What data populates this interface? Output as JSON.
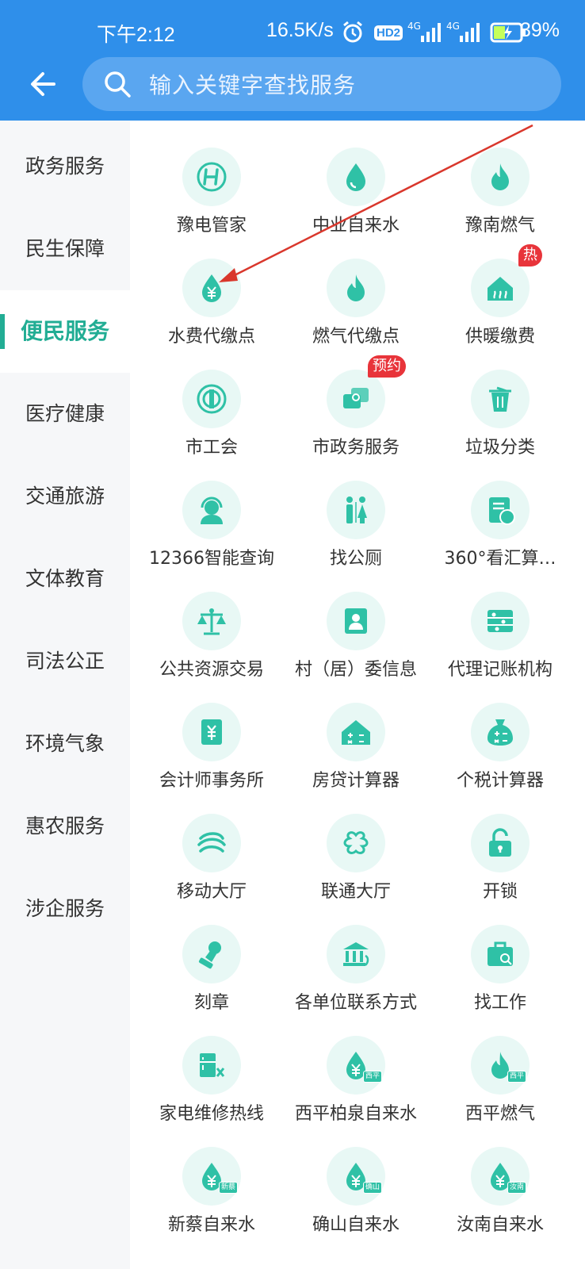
{
  "status_bar": {
    "time": "下午2:12",
    "net_speed": "16.5K/s",
    "battery": "39%",
    "hd": "HD2",
    "net1": "4G",
    "net2": "4G"
  },
  "search": {
    "placeholder": "输入关键字查找服务"
  },
  "sidebar": {
    "items": [
      {
        "label": "政务服务"
      },
      {
        "label": "民生保障"
      },
      {
        "label": "便民服务",
        "active": true
      },
      {
        "label": "医疗健康"
      },
      {
        "label": "交通旅游"
      },
      {
        "label": "文体教育"
      },
      {
        "label": "司法公正"
      },
      {
        "label": "环境气象"
      },
      {
        "label": "惠农服务"
      },
      {
        "label": "涉企服务"
      }
    ]
  },
  "services": [
    {
      "label": "豫电管家",
      "icon": "h-logo-icon"
    },
    {
      "label": "中业自来水",
      "icon": "water-drop-icon"
    },
    {
      "label": "豫南燃气",
      "icon": "flame-icon"
    },
    {
      "label": "水费代缴点",
      "icon": "water-yuan-icon"
    },
    {
      "label": "燃气代缴点",
      "icon": "flame-icon"
    },
    {
      "label": "供暖缴费",
      "icon": "heating-house-icon",
      "badge": "热"
    },
    {
      "label": "市工会",
      "icon": "union-logo-icon"
    },
    {
      "label": "市政务服务",
      "icon": "chat-service-icon",
      "badge": "预约"
    },
    {
      "label": "垃圾分类",
      "icon": "trash-bin-icon"
    },
    {
      "label": "12366智能查询",
      "icon": "headset-agent-icon"
    },
    {
      "label": "找公厕",
      "icon": "toilet-icon"
    },
    {
      "label": "360°看汇算…",
      "icon": "tax-doc-icon"
    },
    {
      "label": "公共资源交易",
      "icon": "scale-icon"
    },
    {
      "label": "村（居）委信息",
      "icon": "id-badge-icon"
    },
    {
      "label": "代理记账机构",
      "icon": "abacus-icon"
    },
    {
      "label": "会计师事务所",
      "icon": "yuan-book-icon"
    },
    {
      "label": "房贷计算器",
      "icon": "house-calc-icon"
    },
    {
      "label": "个税计算器",
      "icon": "money-bag-calc-icon"
    },
    {
      "label": "移动大厅",
      "icon": "china-mobile-icon"
    },
    {
      "label": "联通大厅",
      "icon": "china-unicom-icon"
    },
    {
      "label": "开锁",
      "icon": "padlock-icon"
    },
    {
      "label": "刻章",
      "icon": "stamp-icon"
    },
    {
      "label": "各单位联系方式",
      "icon": "bank-phone-icon"
    },
    {
      "label": "找工作",
      "icon": "briefcase-search-icon"
    },
    {
      "label": "家电维修热线",
      "icon": "appliance-repair-icon"
    },
    {
      "label": "西平柏泉自来水",
      "icon": "water-yuan-icon",
      "tag": "西平"
    },
    {
      "label": "西平燃气",
      "icon": "flame-icon",
      "tag": "西平"
    },
    {
      "label": "新蔡自来水",
      "icon": "water-yuan-icon",
      "tag": "新蔡"
    },
    {
      "label": "确山自来水",
      "icon": "water-yuan-icon",
      "tag": "确山"
    },
    {
      "label": "汝南自来水",
      "icon": "water-yuan-icon",
      "tag": "汝南"
    }
  ],
  "colors": {
    "header": "#2f8fea",
    "accent": "#22ad94",
    "icon_bg": "#e8f8f5",
    "badge": "#e8343a"
  }
}
